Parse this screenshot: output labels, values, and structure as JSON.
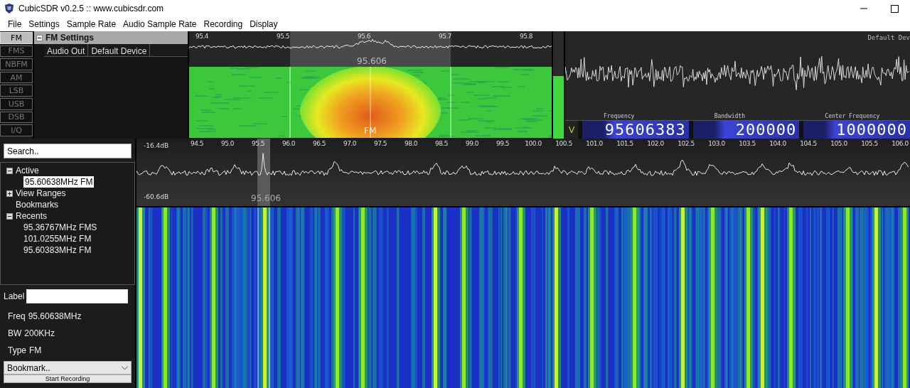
{
  "window": {
    "title": "CubicSDR v0.2.5 :: www.cubicsdr.com"
  },
  "menu": [
    "File",
    "Settings",
    "Sample Rate",
    "Audio Sample Rate",
    "Recording",
    "Display"
  ],
  "modes": [
    {
      "label": "FM",
      "selected": true
    },
    {
      "label": "FMS",
      "selected": false
    },
    {
      "label": "NBFM",
      "selected": false
    },
    {
      "label": "AM",
      "selected": false
    },
    {
      "label": "LSB",
      "selected": false
    },
    {
      "label": "USB",
      "selected": false
    },
    {
      "label": "DSB",
      "selected": false
    },
    {
      "label": "I/Q",
      "selected": false
    }
  ],
  "mode_settings": {
    "title": "FM Settings",
    "expanded": true,
    "rows": [
      {
        "name": "Audio Out",
        "value": "Default Device"
      }
    ]
  },
  "demod_view": {
    "ticks": [
      "95.4",
      "95.5",
      "95.6",
      "95.7",
      "95.8"
    ],
    "center_label": "95.606",
    "waterfall_label": "FM"
  },
  "meter": {
    "level": 0.58
  },
  "scope": {
    "device": "Default Dev"
  },
  "displays_prefix": "V",
  "displays": [
    {
      "label": "Frequency",
      "value": "95606383"
    },
    {
      "label": "Bandwidth",
      "value": "200000"
    },
    {
      "label": "Center Frequency",
      "value": "1000000"
    }
  ],
  "sidebar": {
    "search_placeholder": "Search..",
    "tree": [
      {
        "label": "Active",
        "expanded": true,
        "selected": false,
        "children": [
          {
            "label": "95.60638MHz FM",
            "selected": true
          }
        ]
      },
      {
        "label": "View Ranges",
        "expanded": false,
        "selected": false
      },
      {
        "label": "Bookmarks",
        "selected": false
      },
      {
        "label": "Recents",
        "expanded": true,
        "selected": false,
        "children": [
          {
            "label": "95.36767MHz FMS",
            "selected": false
          },
          {
            "label": "101.0255MHz FM",
            "selected": false
          },
          {
            "label": "95.60383MHz FM",
            "selected": false
          }
        ]
      }
    ],
    "label_field": "Label",
    "info": [
      {
        "key": "Freq",
        "value": "95.60638MHz"
      },
      {
        "key": "BW",
        "value": "200KHz"
      },
      {
        "key": "Type",
        "value": "FM"
      }
    ],
    "bookmark_select": "Bookmark..",
    "record_button": "Start Recording"
  },
  "spectrum": {
    "db_top": "-16.4dB",
    "db_bottom": "-60.6dB",
    "marker_label": "95.606",
    "ticks": [
      "94.5",
      "95.0",
      "95.5",
      "96.0",
      "96.5",
      "97.0",
      "97.5",
      "98.0",
      "98.5",
      "99.0",
      "99.5",
      "100.0",
      "100.5",
      "101.0",
      "101.5",
      "102.0",
      "102.5",
      "103.0",
      "103.5",
      "104.0",
      "104.5",
      "105.0",
      "105.5",
      "106.0"
    ]
  }
}
